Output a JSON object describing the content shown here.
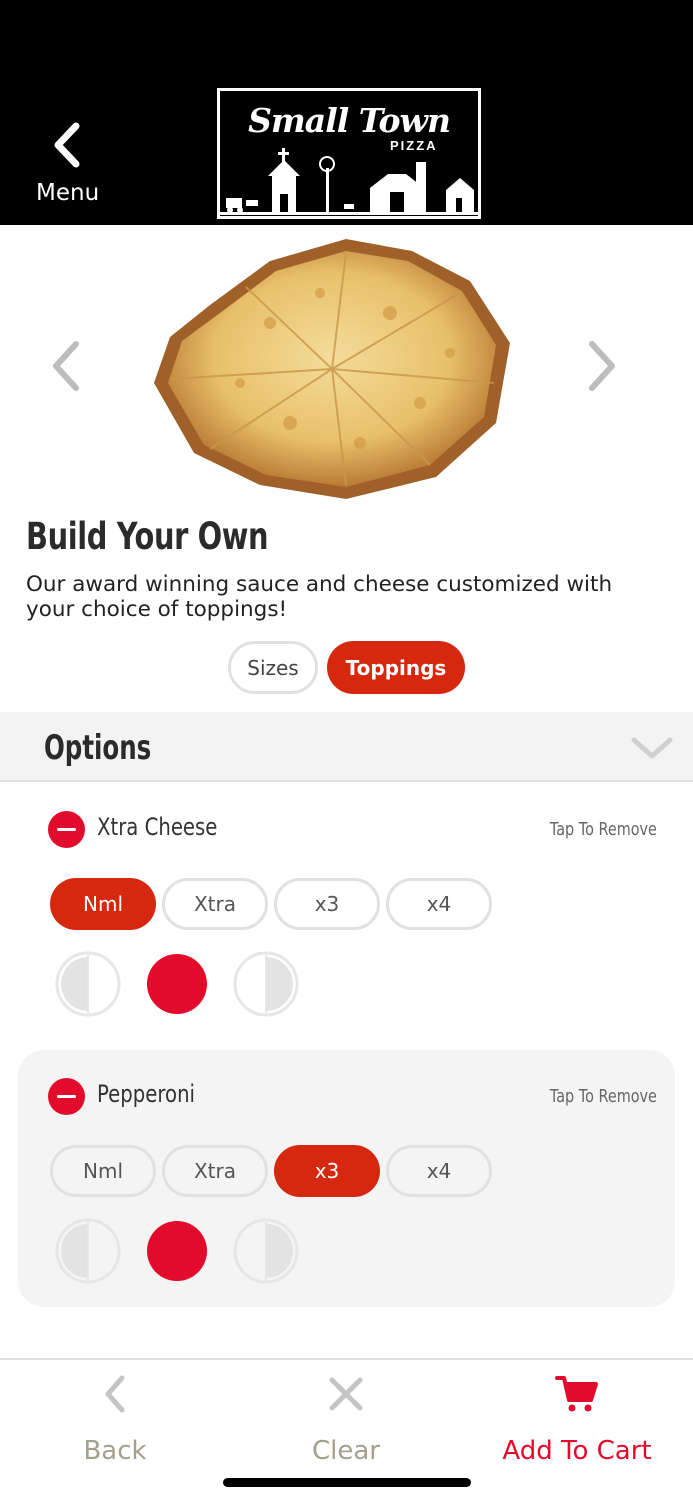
{
  "header": {
    "back_label": "Menu",
    "logo_script": "Small Town",
    "logo_sub": "PIZZA"
  },
  "product": {
    "title": "Build Your Own",
    "description": "Our award winning sauce and cheese customized with your choice of toppings!"
  },
  "tabs": [
    {
      "label": "Sizes",
      "active": false
    },
    {
      "label": "Toppings",
      "active": true
    }
  ],
  "options": {
    "title": "Options",
    "items": [
      {
        "name": "Xtra Cheese",
        "remove_hint": "Tap To Remove",
        "amounts": [
          "Nml",
          "Xtra",
          "x3",
          "x4"
        ],
        "selected_amount": "Nml",
        "selected_portion": "whole"
      },
      {
        "name": "Pepperoni",
        "remove_hint": "Tap To Remove",
        "amounts": [
          "Nml",
          "Xtra",
          "x3",
          "x4"
        ],
        "selected_amount": "x3",
        "selected_portion": "whole"
      }
    ]
  },
  "bottom_bar": {
    "back_label": "Back",
    "clear_label": "Clear",
    "add_label": "Add To Cart"
  },
  "colors": {
    "accent": "#d5280f",
    "remove_red": "#e30b2b",
    "muted_text": "#a3a08e"
  },
  "icons": [
    "chevron-left-icon",
    "chevron-right-icon",
    "chevron-down-icon",
    "minus-circle-icon",
    "close-icon",
    "cart-icon"
  ]
}
